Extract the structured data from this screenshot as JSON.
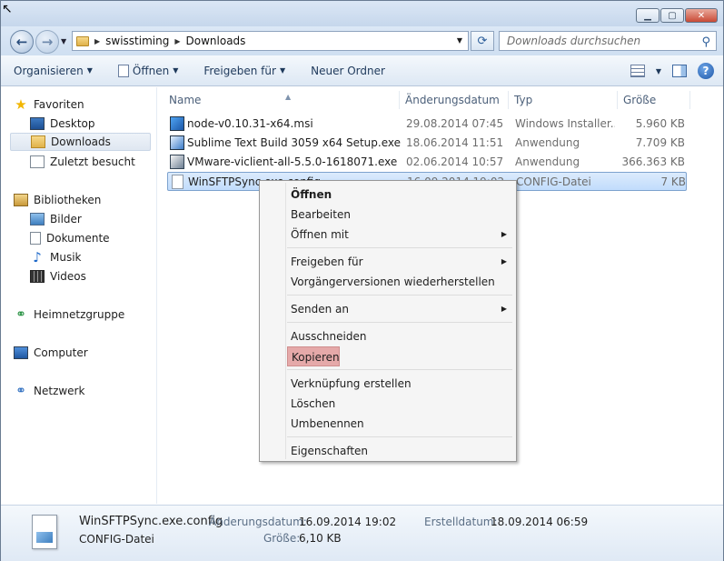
{
  "window": {
    "caption_buttons": [
      "minimize-icon",
      "maximize-icon",
      "close-icon"
    ],
    "accent_color": "#c94a36"
  },
  "address": {
    "breadcrumbs": [
      "swisstiming",
      "Downloads"
    ],
    "search_placeholder": "Downloads durchsuchen"
  },
  "toolbar": {
    "organize": "Organisieren",
    "open": "Öffnen",
    "share": "Freigeben für",
    "new_folder": "Neuer Ordner"
  },
  "sidebar": {
    "favorites": "Favoriten",
    "desktop": "Desktop",
    "downloads": "Downloads",
    "recent": "Zuletzt besucht",
    "libraries": "Bibliotheken",
    "pictures": "Bilder",
    "documents": "Dokumente",
    "music": "Musik",
    "videos": "Videos",
    "homegroup": "Heimnetzgruppe",
    "computer": "Computer",
    "network": "Netzwerk"
  },
  "columns": {
    "name": "Name",
    "date": "Änderungsdatum",
    "type": "Typ",
    "size": "Größe"
  },
  "files": [
    {
      "name": "node-v0.10.31-x64.msi",
      "date": "29.08.2014 07:45",
      "type": "Windows Installer...",
      "size": "5.960 KB"
    },
    {
      "name": "Sublime Text Build 3059 x64 Setup.exe",
      "date": "18.06.2014 11:51",
      "type": "Anwendung",
      "size": "7.709 KB"
    },
    {
      "name": "VMware-viclient-all-5.5.0-1618071.exe",
      "date": "02.06.2014 10:57",
      "type": "Anwendung",
      "size": "366.363 KB"
    },
    {
      "name": "WinSFTPSync.exe.config",
      "date": "16.09.2014 19:02",
      "type": "CONFIG-Datei",
      "size": "7 KB"
    }
  ],
  "context_menu": {
    "open": "Öffnen",
    "edit": "Bearbeiten",
    "open_with": "Öffnen mit",
    "share": "Freigeben für",
    "restore": "Vorgängerversionen wiederherstellen",
    "send_to": "Senden an",
    "cut": "Ausschneiden",
    "copy": "Kopieren",
    "shortcut": "Verknüpfung erstellen",
    "delete": "Löschen",
    "rename": "Umbenennen",
    "properties": "Eigenschaften",
    "highlight_color": "#e5a9a9"
  },
  "details": {
    "filename": "WinSFTPSync.exe.config",
    "filetype": "CONFIG-Datei",
    "modified_label": "Änderungsdatum:",
    "modified_value": "16.09.2014 19:02",
    "created_label": "Erstelldatum:",
    "created_value": "18.09.2014 06:59",
    "size_label": "Größe:",
    "size_value": "6,10 KB"
  }
}
